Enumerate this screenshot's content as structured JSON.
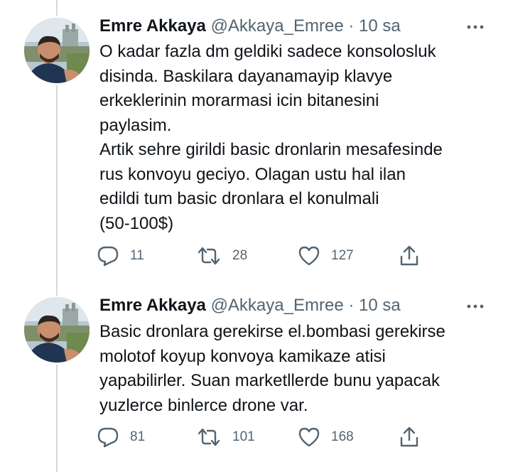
{
  "tweets": [
    {
      "author_name": "Emre Akkaya",
      "handle": "@Akkaya_Emree",
      "separator": "·",
      "time": "10 sa",
      "lines": [
        "O kadar fazla dm geldiki sadece konsolosluk",
        "disinda. Baskilara dayanamayip klavye",
        "erkeklerinin morarmasi icin bitanesini",
        "paylasim.",
        "Artik sehre girildi basic dronlarin mesafesinde",
        "rus konvoyu geciyo. Olagan ustu hal ilan",
        "edildi tum basic dronlara el konulmali",
        "(50-100$)"
      ],
      "replies": "11",
      "retweets": "28",
      "likes": "127"
    },
    {
      "author_name": "Emre Akkaya",
      "handle": "@Akkaya_Emree",
      "separator": "·",
      "time": "10 sa",
      "lines": [
        "Basic dronlara gerekirse el.bombasi gerekirse",
        "molotof koyup konvoya kamikaze atisi",
        "yapabilirler. Suan marketllerde bunu yapacak",
        "yuzlerce binlerce drone var."
      ],
      "replies": "81",
      "retweets": "101",
      "likes": "168"
    }
  ],
  "icons": {
    "reply": "reply-icon",
    "retweet": "retweet-icon",
    "like": "heart-icon",
    "share": "share-icon",
    "more": "more-icon",
    "avatar": "avatar"
  },
  "colors": {
    "text": "#0f1419",
    "secondary": "#536471",
    "thread_line": "#cfd9de",
    "background": "#ffffff"
  }
}
